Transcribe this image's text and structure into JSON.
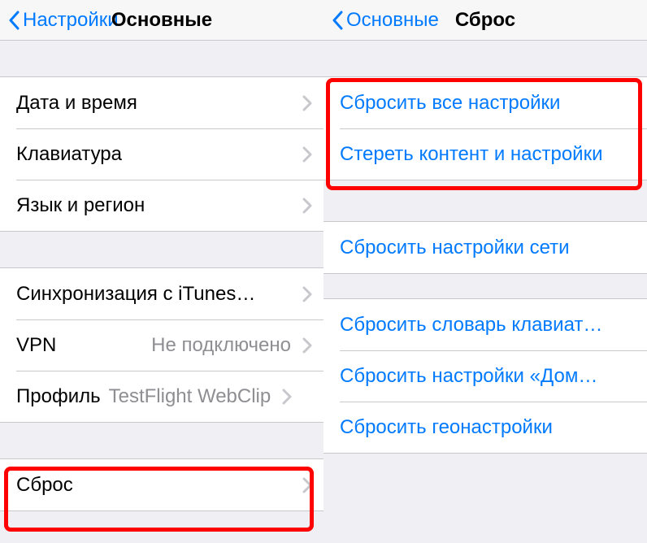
{
  "left": {
    "back_label": "Настройки",
    "title": "Основные",
    "cells": {
      "date_time": "Дата и время",
      "keyboard": "Клавиатура",
      "language_region": "Язык и регион",
      "itunes_sync": "Синхронизация с iTunes…",
      "vpn_label": "VPN",
      "vpn_value": "Не подключено",
      "profile_label": "Профиль",
      "profile_value": "TestFlight WebClip",
      "reset": "Сброс"
    }
  },
  "right": {
    "back_label": "Основные",
    "title": "Сброс",
    "cells": {
      "reset_all": "Сбросить все настройки",
      "erase_all": "Стереть контент и настройки",
      "reset_network": "Сбросить настройки сети",
      "reset_keyboard_dict": "Сбросить словарь клавиат…",
      "reset_home": "Сбросить настройки «Дом…",
      "reset_location": "Сбросить геонастройки"
    }
  }
}
